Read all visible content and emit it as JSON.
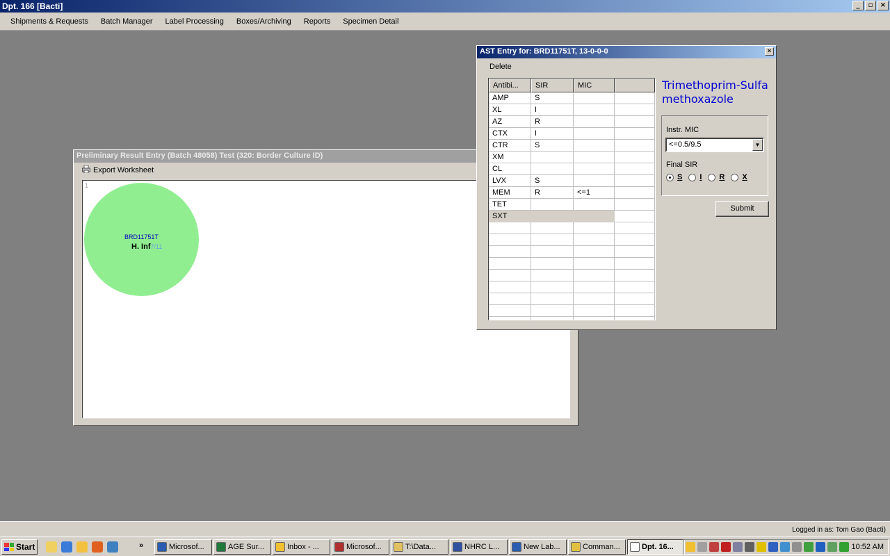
{
  "app": {
    "title": "Dpt. 166 [Bacti]"
  },
  "window_controls": {
    "minimize": "_",
    "maximize": "▫",
    "close": "×"
  },
  "menu": [
    "Shipments & Requests",
    "Batch Manager",
    "Label Processing",
    "Boxes/Archiving",
    "Reports",
    "Specimen Detail"
  ],
  "prelim": {
    "title": "Preliminary Result Entry (Batch 48058) Test (320: Border Culture ID)",
    "export_label": "Export Worksheet",
    "canvas_index": "1",
    "specimen_id": "BRD11751T",
    "organism": "H. Inf",
    "fraction": "7/11"
  },
  "ast": {
    "title": "AST Entry for: BRD11751T, 13-0-0-0",
    "close": "×",
    "delete_label": "Delete",
    "columns": [
      "Antibi...",
      "SIR",
      "MIC",
      ""
    ],
    "rows": [
      {
        "ab": "AMP",
        "sir": "S",
        "mic": ""
      },
      {
        "ab": "XL",
        "sir": "I",
        "mic": ""
      },
      {
        "ab": "AZ",
        "sir": "R",
        "mic": ""
      },
      {
        "ab": "CTX",
        "sir": "I",
        "mic": ""
      },
      {
        "ab": "CTR",
        "sir": "S",
        "mic": ""
      },
      {
        "ab": "XM",
        "sir": "",
        "mic": ""
      },
      {
        "ab": "CL",
        "sir": "",
        "mic": ""
      },
      {
        "ab": "LVX",
        "sir": "S",
        "mic": ""
      },
      {
        "ab": "MEM",
        "sir": "R",
        "mic": "<=1"
      },
      {
        "ab": "TET",
        "sir": "",
        "mic": ""
      },
      {
        "ab": "SXT",
        "sir": "",
        "mic": ""
      }
    ],
    "selected_row": "SXT",
    "drug_name": "Trimethoprim-Sulfamethoxazole",
    "instr_mic_label": "Instr. MIC",
    "instr_mic_value": "<=0.5/9.5",
    "final_sir_label": "Final SIR",
    "sir_options": [
      "S",
      "I",
      "R",
      "X"
    ],
    "sir_selected": "S",
    "submit_label": "Submit"
  },
  "status": {
    "logged_in": "Logged in as: Tom Gao (Bacti)"
  },
  "taskbar": {
    "start": "Start",
    "more": "»",
    "tasks": [
      "Microsof...",
      "AGE Sur...",
      "Inbox - ...",
      "Microsof...",
      "T:\\Data...",
      "NHRC L...",
      "New Lab...",
      "Comman...",
      "Dpt. 16..."
    ],
    "active_task": "Dpt. 16...",
    "clock": "10:52 AM"
  },
  "colors": {
    "accent": "#0a246a",
    "drug_name": "#0000d0",
    "circle": "#90ee90"
  }
}
